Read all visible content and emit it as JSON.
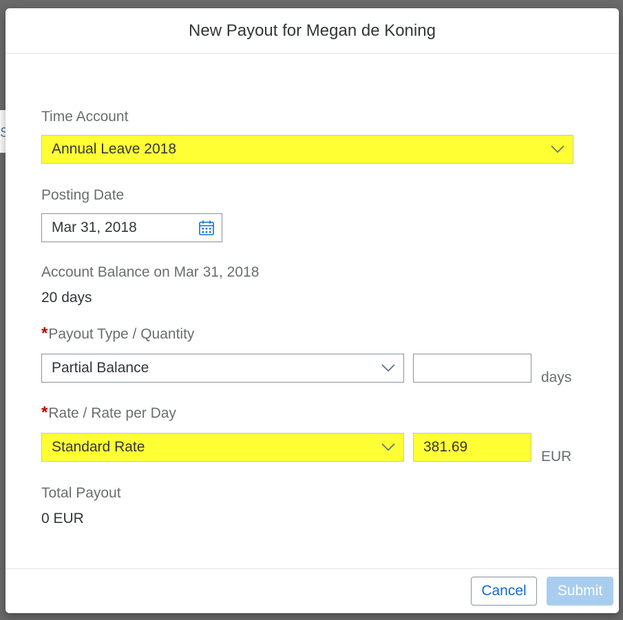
{
  "backdrop": {
    "partial_letter": "S"
  },
  "dialog": {
    "title": "New Payout for Megan de Koning",
    "time_account": {
      "label": "Time Account",
      "value": "Annual Leave 2018"
    },
    "posting_date": {
      "label": "Posting Date",
      "value": "Mar 31, 2018"
    },
    "account_balance": {
      "label": "Account Balance on Mar 31, 2018",
      "value": "20 days"
    },
    "payout_type": {
      "required_mark": "*",
      "label": "Payout Type / Quantity",
      "type_value": "Partial Balance",
      "quantity_value": "",
      "unit": "days"
    },
    "rate": {
      "required_mark": "*",
      "label": "Rate / Rate per Day",
      "type_value": "Standard Rate",
      "amount_value": "381.69",
      "unit": "EUR"
    },
    "total_payout": {
      "label": "Total Payout",
      "value": "0 EUR"
    },
    "footer": {
      "cancel_label": "Cancel",
      "submit_label": "Submit",
      "submit_enabled": false
    },
    "colors": {
      "highlight": "#ffff33",
      "accent": "#0a6ed1",
      "required": "#bb0000",
      "submit_disabled": "#a9cdef"
    },
    "icons": [
      "chevron-down-icon",
      "calendar-icon"
    ]
  }
}
